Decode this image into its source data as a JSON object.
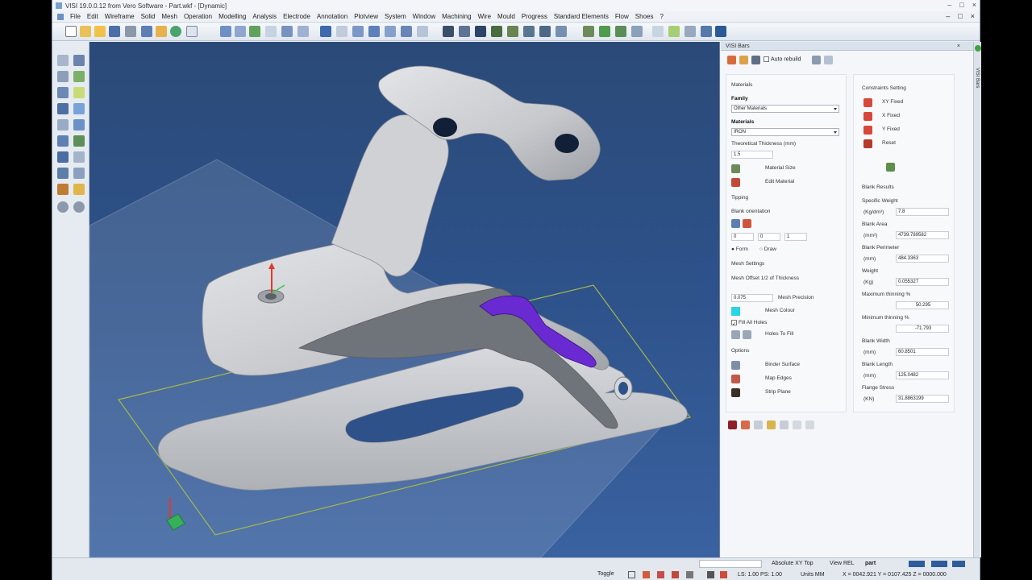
{
  "window": {
    "title": "VISI 19.0.0.12 from Vero Software - Part.wkf - [Dynamic]",
    "controls": [
      "–",
      "□",
      "×"
    ]
  },
  "menu": [
    "File",
    "Edit",
    "Wireframe",
    "Solid",
    "Mesh",
    "Operation",
    "Modelling",
    "Analysis",
    "Electrode",
    "Annotation",
    "Plotview",
    "System",
    "Window",
    "Machining",
    "Wire",
    "Mould",
    "Progress",
    "Standard Elements",
    "Flow",
    "Shoes",
    "?"
  ],
  "panel": {
    "title": "VISI Bars",
    "auto_rebuild_label": "Auto rebuild",
    "auto_rebuild": false,
    "side_tab": "VISI Bars",
    "materials": {
      "section_label": "Materials",
      "family_label": "Family",
      "family_value": "Other Materials",
      "materials_label": "Materials",
      "materials_value": "IRON",
      "thickness_label": "Theoretical Thickness (mm)",
      "thickness_value": "1.5",
      "material_size_label": "Material Size",
      "edit_material_label": "Edit Material"
    },
    "tipping": {
      "section_label": "Tipping",
      "orientation_label": "Blank orientation",
      "values": [
        "0",
        "0",
        "1"
      ],
      "form_label": "Form",
      "draw_label": "Draw",
      "selected": "Form"
    },
    "mesh": {
      "section_label": "Mesh Settings",
      "offset_label": "Mesh Offset 1/2 of Thickness",
      "precision_value": "0.075",
      "precision_label": "Mesh Precision",
      "colour_label": "Mesh Colour",
      "colour": "#28d4e6",
      "fill_holes_label": "Fill All Holes",
      "fill_holes": true,
      "holes_to_fill_label": "Holes To Fill"
    },
    "options": {
      "section_label": "Options",
      "items": [
        "Binder Surface",
        "Map Edges",
        "Strip Plane"
      ]
    },
    "constraints": {
      "section_label": "Constraints Setting",
      "items": [
        "XY Fixed",
        "X Fixed",
        "Y Fixed",
        "Reset"
      ]
    },
    "results": {
      "section_label": "Blank Results",
      "rows": [
        {
          "name": "Specific Weight",
          "unit": "(Kg/dm³)",
          "value": "7.8"
        },
        {
          "name": "Blank Area",
          "unit": "(mm²)",
          "value": "4739.789582"
        },
        {
          "name": "Blank Perimeter",
          "unit": "(mm)",
          "value": "484.3363"
        },
        {
          "name": "Weight",
          "unit": "(Kg)",
          "value": "0.055327"
        },
        {
          "name": "Maximum thinning %",
          "unit": "",
          "value": "50.295"
        },
        {
          "name": "Minimum thinning %",
          "unit": "",
          "value": "-71.793"
        },
        {
          "name": "Blank Width",
          "unit": "(mm)",
          "value": "60.8501"
        },
        {
          "name": "Blank Length",
          "unit": "(mm)",
          "value": "125.0482"
        },
        {
          "name": "Flange Stress",
          "unit": "(KN)",
          "value": "31.8863199"
        }
      ]
    }
  },
  "statusbar": {
    "view_mode": "Absolute XY Top",
    "view_rel": "View REL",
    "part": "part",
    "toggle": "Toggle",
    "scale": "LS: 1.00 PS: 1.00",
    "units": "Units MM",
    "coords": "X = 0042.921 Y = 0107.425 Z = 0000.000"
  },
  "colors": {
    "accent": "#2f5c9a",
    "viewport_top": "#2b4a78",
    "viewport_bottom": "#3a62a0",
    "highlight": "#6a2ad1"
  }
}
